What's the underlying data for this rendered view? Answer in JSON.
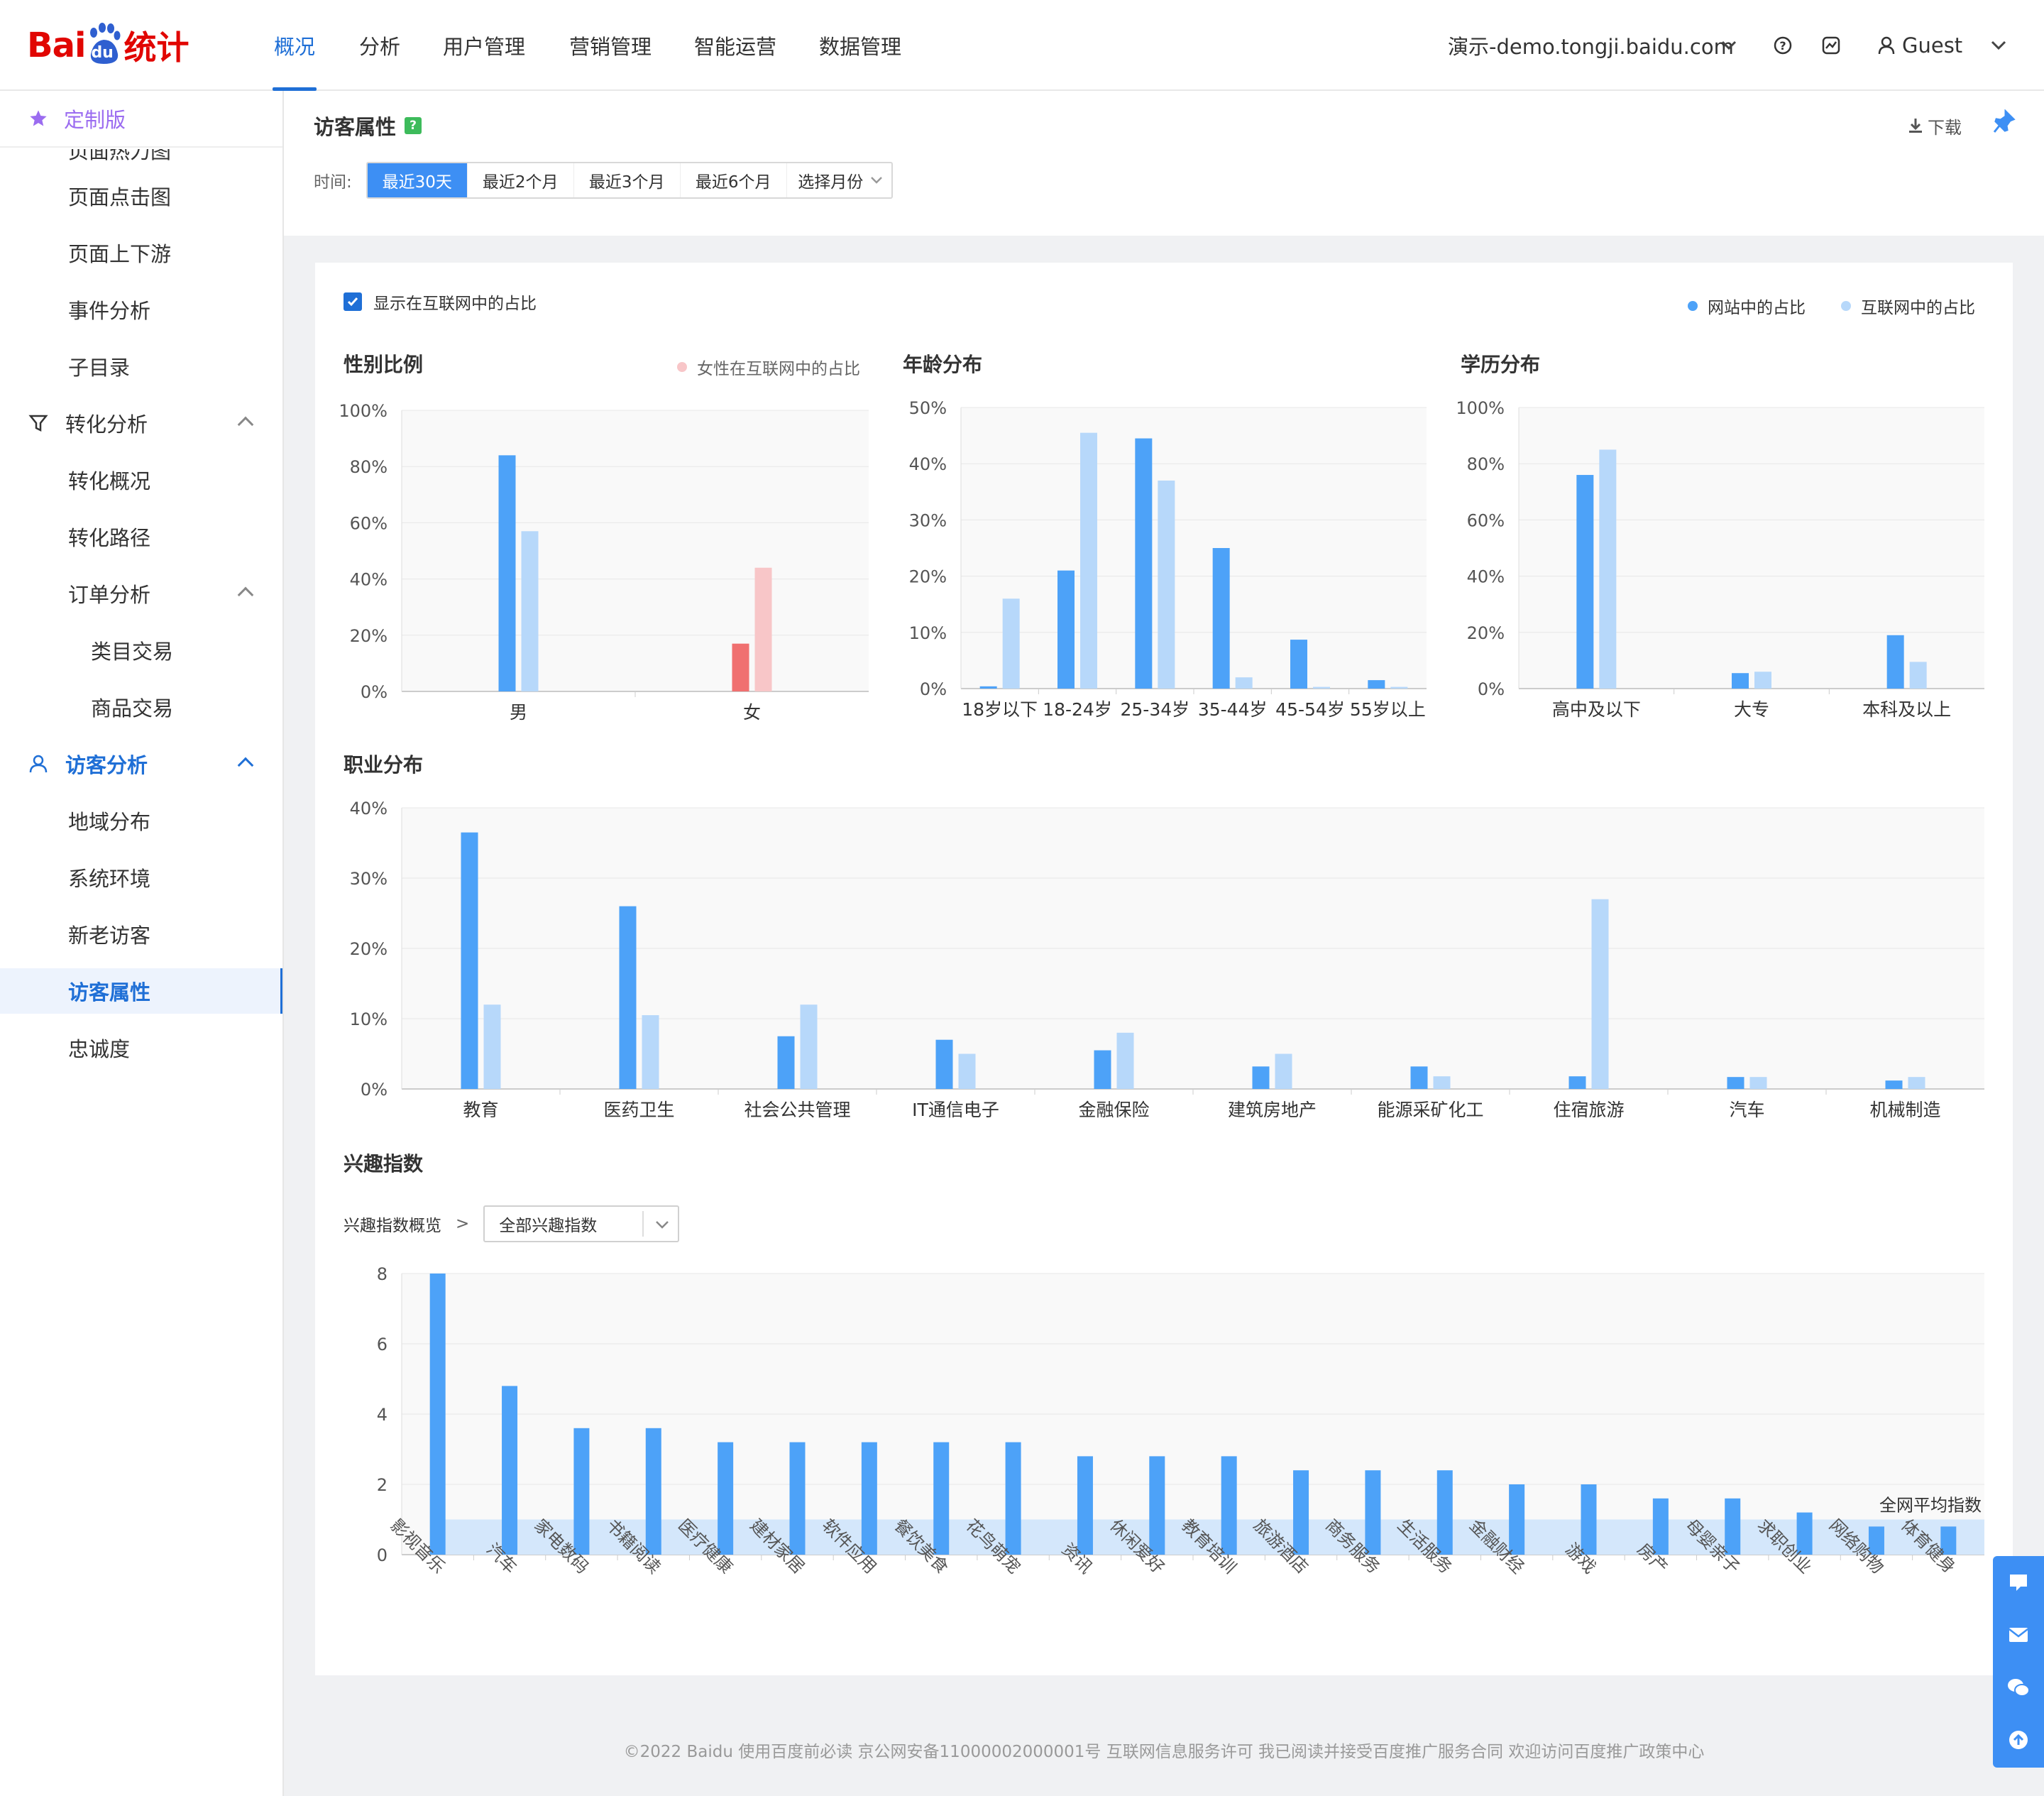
{
  "app": {
    "logo_text": "Bai",
    "logo_paw_text": "du",
    "logo_suffix": "统计"
  },
  "nav": {
    "items": [
      "概况",
      "分析",
      "用户管理",
      "营销管理",
      "智能运营",
      "数据管理"
    ],
    "active_index": 0
  },
  "topright": {
    "site": "演示-demo.tongji.baidu.com",
    "user": "Guest"
  },
  "sidebar": {
    "header": "定制版",
    "items": [
      {
        "label": "页面点击图",
        "level": 2
      },
      {
        "label": "页面上下游",
        "level": 2
      },
      {
        "label": "事件分析",
        "level": 2
      },
      {
        "label": "子目录",
        "level": 2
      },
      {
        "label": "转化分析",
        "level": 1,
        "icon": "funnel-icon",
        "expanded": true
      },
      {
        "label": "转化概况",
        "level": 2
      },
      {
        "label": "转化路径",
        "level": 2
      },
      {
        "label": "订单分析",
        "level": 2,
        "expanded": true
      },
      {
        "label": "类目交易",
        "level": 3
      },
      {
        "label": "商品交易",
        "level": 3
      },
      {
        "label": "访客分析",
        "level": 1,
        "icon": "user-icon",
        "expanded": true,
        "highlight": true
      },
      {
        "label": "地域分布",
        "level": 2
      },
      {
        "label": "系统环境",
        "level": 2
      },
      {
        "label": "新老访客",
        "level": 2
      },
      {
        "label": "访客属性",
        "level": 2,
        "selected": true
      },
      {
        "label": "忠诚度",
        "level": 2
      }
    ]
  },
  "page": {
    "title": "访客属性",
    "download": "下载",
    "time_label": "时间:",
    "time_options": [
      "最近30天",
      "最近2个月",
      "最近3个月",
      "最近6个月",
      "选择月份"
    ],
    "time_active": 0
  },
  "card": {
    "checkbox_label": "显示在互联网中的占比",
    "legend": [
      "网站中的占比",
      "互联网中的占比"
    ],
    "gender_note": "女性在互联网中的占比",
    "interest_crumb": "兴趣指数概览",
    "interest_crumb_sep": ">",
    "interest_select": "全部兴趣指数",
    "avg_label": "全网平均指数"
  },
  "colors": {
    "site": "#4da2f8",
    "internet": "#b7d8fa",
    "female": "#f07070",
    "female_light": "#f8c6c8",
    "accent": "#1f6fd6",
    "avg_band": "#d4e7fb"
  },
  "chart_data": [
    {
      "type": "bar",
      "title": "性别比例",
      "categories": [
        "男",
        "女"
      ],
      "ylim": [
        0,
        100
      ],
      "yticks": [
        "0%",
        "20%",
        "40%",
        "60%",
        "80%",
        "100%"
      ],
      "series": [
        {
          "name": "网站中的占比",
          "values": [
            84,
            17
          ]
        },
        {
          "name": "互联网中的占比",
          "values": [
            57,
            44
          ]
        }
      ]
    },
    {
      "type": "bar",
      "title": "年龄分布",
      "categories": [
        "18岁以下",
        "18-24岁",
        "25-34岁",
        "35-44岁",
        "45-54岁",
        "55岁以上"
      ],
      "ylim": [
        0,
        50
      ],
      "yticks": [
        "0%",
        "10%",
        "20%",
        "30%",
        "40%",
        "50%"
      ],
      "series": [
        {
          "name": "网站中的占比",
          "values": [
            0.4,
            21,
            44.5,
            25,
            8.7,
            1.5
          ]
        },
        {
          "name": "互联网中的占比",
          "values": [
            16,
            45.5,
            37,
            2,
            0.3,
            0.3
          ]
        }
      ]
    },
    {
      "type": "bar",
      "title": "学历分布",
      "categories": [
        "高中及以下",
        "大专",
        "本科及以上"
      ],
      "ylim": [
        0,
        100
      ],
      "yticks": [
        "0%",
        "20%",
        "40%",
        "60%",
        "80%",
        "100%"
      ],
      "series": [
        {
          "name": "网站中的占比",
          "values": [
            76,
            5.5,
            19
          ]
        },
        {
          "name": "互联网中的占比",
          "values": [
            85,
            6,
            9.5
          ]
        }
      ]
    },
    {
      "type": "bar",
      "title": "职业分布",
      "categories": [
        "教育",
        "医药卫生",
        "社会公共管理",
        "IT通信电子",
        "金融保险",
        "建筑房地产",
        "能源采矿化工",
        "住宿旅游",
        "汽车",
        "机械制造"
      ],
      "ylim": [
        0,
        40
      ],
      "yticks": [
        "0%",
        "10%",
        "20%",
        "30%",
        "40%"
      ],
      "series": [
        {
          "name": "网站中的占比",
          "values": [
            36.5,
            26,
            7.5,
            7,
            5.5,
            3.2,
            3.2,
            1.8,
            1.7,
            1.2
          ]
        },
        {
          "name": "互联网中的占比",
          "values": [
            12,
            10.5,
            12,
            5,
            8,
            5,
            1.8,
            27,
            1.7,
            1.7
          ]
        }
      ]
    },
    {
      "type": "bar",
      "title": "兴趣指数",
      "categories": [
        "影视音乐",
        "汽车",
        "家电数码",
        "书籍阅读",
        "医疗健康",
        "建材家居",
        "软件应用",
        "餐饮美食",
        "花鸟萌宠",
        "资讯",
        "休闲爱好",
        "教育培训",
        "旅游酒店",
        "商务服务",
        "生活服务",
        "金融财经",
        "游戏",
        "房产",
        "母婴亲子",
        "求职创业",
        "网络购物",
        "体育健身"
      ],
      "ylim": [
        0,
        8
      ],
      "yticks": [
        "0",
        "2",
        "4",
        "6",
        "8"
      ],
      "series": [
        {
          "name": "兴趣指数",
          "values": [
            8,
            4.8,
            3.6,
            3.6,
            3.2,
            3.2,
            3.2,
            3.2,
            3.2,
            2.8,
            2.8,
            2.8,
            2.4,
            2.4,
            2.4,
            2.0,
            2.0,
            1.6,
            1.6,
            1.2,
            0.8,
            0.8
          ]
        }
      ],
      "average": 1
    }
  ],
  "footer": "©2022 Baidu 使用百度前必读 京公网安备11000002000001号 互联网信息服务许可 我已阅读并接受百度推广服务合同 欢迎访问百度推广政策中心"
}
